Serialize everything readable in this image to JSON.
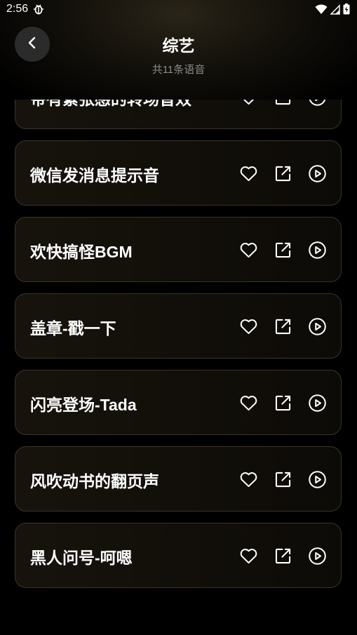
{
  "status_bar": {
    "time": "2:56",
    "app_icon": "bug-icon",
    "icons": [
      "wifi-icon",
      "signal-icon",
      "battery-icon"
    ]
  },
  "header": {
    "back_icon": "chevron-left-icon",
    "title": "综艺",
    "subtitle": "共11条语音"
  },
  "sounds": [
    {
      "title": "带有紧张感的转场音效"
    },
    {
      "title": "微信发消息提示音"
    },
    {
      "title": "欢快搞怪BGM"
    },
    {
      "title": "盖章-戳一下"
    },
    {
      "title": "闪亮登场-Tada"
    },
    {
      "title": "风吹动书的翻页声"
    },
    {
      "title": "黑人问号-呵嗯"
    }
  ],
  "actions": [
    "heart-icon",
    "share-icon",
    "play-icon"
  ],
  "colors": {
    "background": "#000000",
    "card_border": "#3b3428",
    "card_background": "#17130c",
    "subtitle": "#8a8a8a"
  }
}
